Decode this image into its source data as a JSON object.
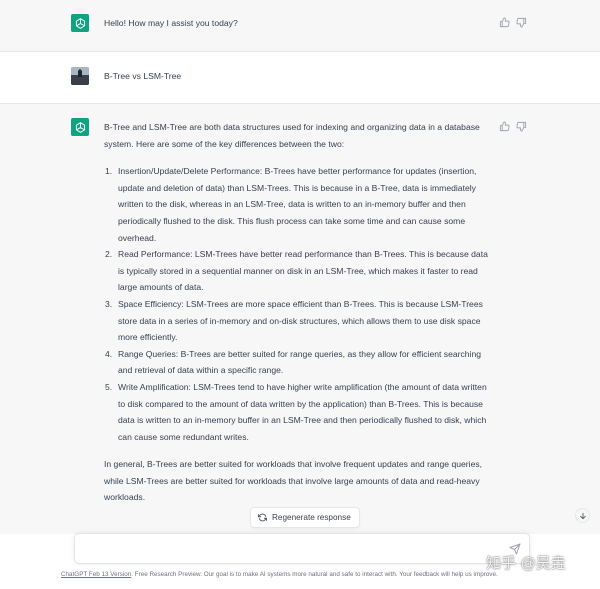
{
  "messages": {
    "greeting": {
      "text": "Hello! How may I assist you today?"
    },
    "user_question": {
      "text": "B-Tree vs LSM-Tree"
    },
    "answer": {
      "intro": "B-Tree and LSM-Tree are both data structures used for indexing and organizing data in a database system. Here are some of the key differences between the two:",
      "points": [
        {
          "num": "1.",
          "text": "Insertion/Update/Delete Performance: B-Trees have better performance for updates (insertion, update and deletion of data) than LSM-Trees. This is because in a B-Tree, data is immediately written to the disk, whereas in an LSM-Tree, data is written to an in-memory buffer and then periodically flushed to the disk. This flush process can take some time and can cause some overhead."
        },
        {
          "num": "2.",
          "text": "Read Performance: LSM-Trees have better read performance than B-Trees. This is because data is typically stored in a sequential manner on disk in an LSM-Tree, which makes it faster to read large amounts of data."
        },
        {
          "num": "3.",
          "text": "Space Efficiency: LSM-Trees are more space efficient than B-Trees. This is because LSM-Trees store data in a series of in-memory and on-disk structures, which allows them to use disk space more efficiently."
        },
        {
          "num": "4.",
          "text": "Range Queries: B-Trees are better suited for range queries, as they allow for efficient searching and retrieval of data within a specific range."
        },
        {
          "num": "5.",
          "text": "Write Amplification: LSM-Trees tend to have higher write amplification (the amount of data written to disk compared to the amount of data written by the application) than B-Trees. This is because data is written to an in-memory buffer in an LSM-Tree and then periodically flushed to disk, which can cause some redundant writes."
        }
      ],
      "conclusion": "In general, B-Trees are better suited for workloads that involve frequent updates and range queries, while LSM-Trees are better suited for workloads that involve large amounts of data and read-heavy workloads."
    }
  },
  "controls": {
    "regenerate_label": "Regenerate response",
    "composer_placeholder": ""
  },
  "footer": {
    "version_link": "ChatGPT Feb 13 Version",
    "note": ". Free Research Preview. Our goal is to make AI systems more natural and safe to interact with. Your feedback will help us improve."
  },
  "watermark": {
    "text": "知乎 @吴垚"
  },
  "icons": {
    "assistant_avatar": "openai-logo-icon",
    "user_avatar": "user-photo-avatar",
    "thumbs_up": "thumbs-up-icon",
    "thumbs_down": "thumbs-down-icon",
    "regenerate": "refresh-icon",
    "scroll_down": "arrow-down-icon",
    "send": "paper-plane-icon"
  },
  "colors": {
    "assistant_avatar_bg": "#10a37f",
    "assistant_row_bg": "#f7f7f8",
    "user_row_bg": "#ffffff",
    "text": "#374151",
    "muted_text": "#6b7280"
  }
}
